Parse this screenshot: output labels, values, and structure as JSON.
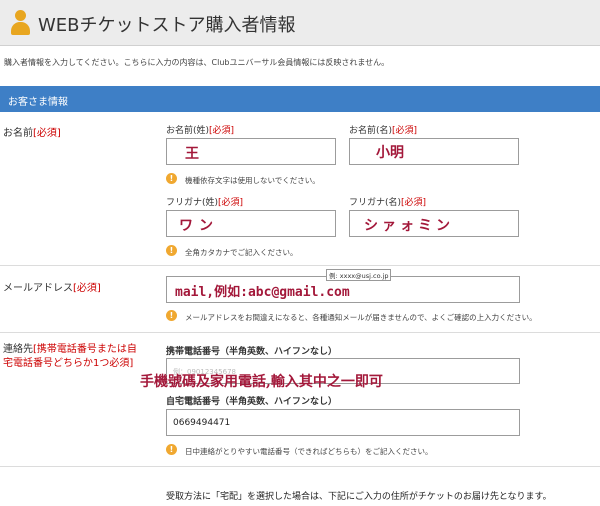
{
  "header": {
    "title": "WEBチケットストア購入者情報",
    "icon": "user-icon"
  },
  "intro": "購入者情報を入力してください。こちらに入力の内容は、Clubユニバーサル会員情報には反映されません。",
  "section": {
    "title": "お客さま情報"
  },
  "name_row": {
    "label": "お名前",
    "required": "[必須]",
    "last_label": "お名前(姓)",
    "first_label": "お名前(名)",
    "last_value": "王",
    "first_value": "小明",
    "note": "機種依存文字は使用しないでください。"
  },
  "kana_row": {
    "last_label": "フリガナ(姓)",
    "first_label": "フリガナ(名)",
    "last_value": "ワン",
    "first_value": "シァォミン",
    "note": "全角カタカナでご記入ください。"
  },
  "email_row": {
    "label": "メールアドレス",
    "required": "[必須]",
    "tooltip": "例: xxxx@usj.co.jp",
    "value": "mail,例如:abc@gmail.com",
    "note": "メールアドレスをお間違えになると、各種通知メールが届きませんので、よくご確認の上入力ください。"
  },
  "contact_row": {
    "label": "連絡先",
    "required_line1": "[携帯電話番号または自",
    "required_line2": "宅電話番号どちらか1つ必須]",
    "mobile_label": "携帯電話番号（半角英数、ハイフンなし）",
    "mobile_value_faint": "例：09012345678",
    "home_label": "自宅電話番号（半角英数、ハイフンなし）",
    "home_value": "0669494471",
    "note": "日中連絡がとりやすい電話番号（できればどちらも）をご記入ください。",
    "overlay_text": "手機號碼及家用電話,輸入其中之一即可"
  },
  "footer_note": "受取方法に「宅配」を選択した場合は、下記にご入力の住所がチケットのお届け先となります。",
  "colors": {
    "section_bar": "#3e7fc6",
    "required": "#cc0000",
    "handwriting": "#a3183a",
    "note_icon": "#f0a830"
  }
}
